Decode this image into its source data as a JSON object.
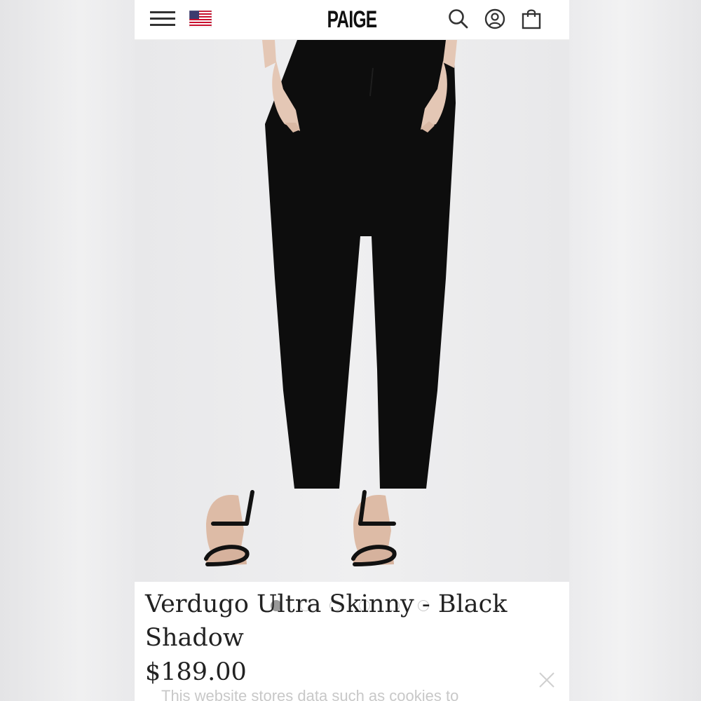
{
  "header": {
    "brand": "PAIGE",
    "menu_icon": "hamburger-menu-icon",
    "region_icon": "us-flag-icon",
    "search_icon": "search-icon",
    "account_icon": "account-icon",
    "bag_icon": "shopping-bag-icon"
  },
  "product": {
    "title": "Verdugo Ultra Skinny - Black Shadow",
    "price": "$189.00",
    "image_index": 1,
    "image_count": 6
  },
  "cookie_banner": {
    "text": "This website stores data such as cookies to",
    "close_icon": "close-icon"
  },
  "colors": {
    "text": "#222222",
    "header_bg": "#ffffff",
    "image_bg": "#ebebec",
    "dot_active": "#999999",
    "dot_inactive": "#c8c8c8"
  }
}
